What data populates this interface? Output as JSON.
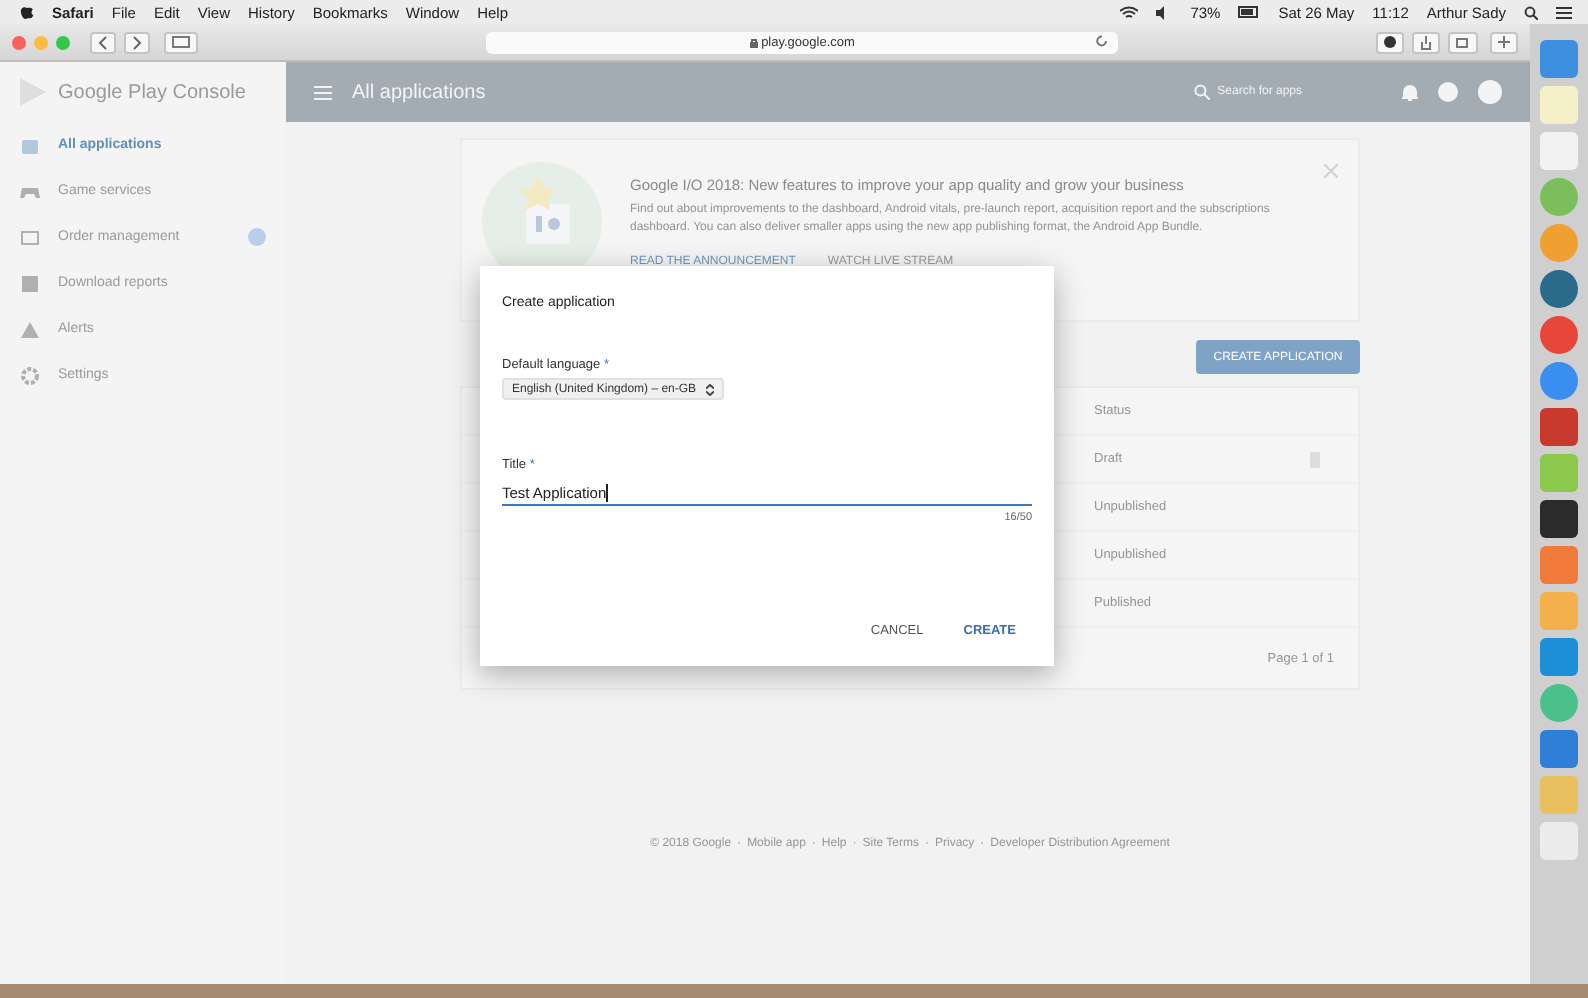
{
  "menubar": {
    "app": "Safari",
    "menus": [
      "File",
      "Edit",
      "View",
      "History",
      "Bookmarks",
      "Window",
      "Help"
    ],
    "battery": "73%",
    "date": "Sat 26 May",
    "time": "11:12",
    "user": "Arthur Sady"
  },
  "browser": {
    "url": "play.google.com"
  },
  "console": {
    "brand": "Google Play Console",
    "page_title": "All applications",
    "search": {
      "placeholder": "Search for apps"
    }
  },
  "sidebar": {
    "items": [
      {
        "label": "All applications",
        "selected": true,
        "badge": false
      },
      {
        "label": "Game services",
        "selected": false,
        "badge": false
      },
      {
        "label": "Order management",
        "selected": false,
        "badge": true
      },
      {
        "label": "Download reports",
        "selected": false,
        "badge": false
      },
      {
        "label": "Alerts",
        "selected": false,
        "badge": false
      },
      {
        "label": "Settings",
        "selected": false,
        "badge": false
      }
    ]
  },
  "banner": {
    "title": "Google I/O 2018: New features to improve your app quality and grow your business",
    "body": "Find out about improvements to the dashboard, Android vitals, pre-launch report, acquisition report and the subscriptions dashboard. You can also deliver smaller apps using the new app publishing format, the Android App Bundle.",
    "links": [
      "READ THE ANNOUNCEMENT",
      "WATCH LIVE STREAM"
    ]
  },
  "create_button": "CREATE APPLICATION",
  "table": {
    "columns": [
      "Status"
    ],
    "rows": [
      {
        "status": "Draft",
        "deletable": true
      },
      {
        "status": "Unpublished",
        "deletable": false
      },
      {
        "status": "Unpublished",
        "deletable": false
      },
      {
        "status": "Published",
        "deletable": false
      }
    ],
    "pagination": "Page 1 of 1"
  },
  "footer": {
    "separator": "·",
    "links": [
      "© 2018 Google",
      "Mobile app",
      "Help",
      "Site Terms",
      "Privacy",
      "Developer Distribution Agreement"
    ]
  },
  "dialog": {
    "title": "Create application",
    "fields": [
      {
        "kind": "select",
        "label": "Default language",
        "required_mark": "*",
        "value": "English (United Kingdom) – en-GB"
      },
      {
        "kind": "text",
        "label": "Title",
        "required_mark": "*",
        "value": "Test Application",
        "counter": "16/50",
        "focused": true
      }
    ],
    "buttons": [
      {
        "label": "CANCEL",
        "primary": false
      },
      {
        "label": "CREATE",
        "primary": true
      }
    ]
  }
}
